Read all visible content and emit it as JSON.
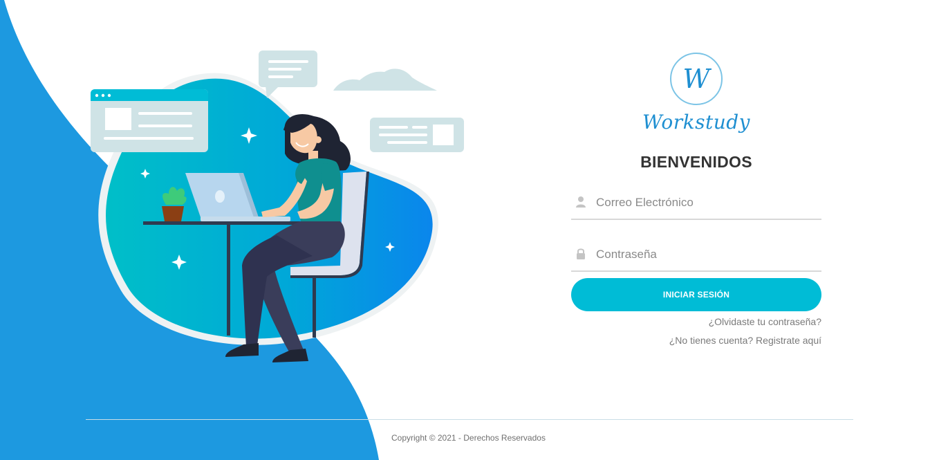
{
  "login": {
    "brand_letter": "W",
    "brand_name": "Workstudy",
    "title": "BIENVENIDOS",
    "email_placeholder": "Correo Electrónico",
    "password_placeholder": "Contraseña",
    "submit_label": "INICIAR SESIÓN",
    "forgot_link": "¿Olvidaste tu contraseña?",
    "register_link": "¿No tienes cuenta? Registrate aquí"
  },
  "footer": {
    "copyright": "Copyright © 2021 - Derechos Reservados"
  },
  "colors": {
    "accent": "#00bcd6",
    "brand": "#1f8fd1",
    "background_wave": "#1d99e0"
  },
  "icons": {
    "email": "user-icon",
    "password": "lock-icon"
  }
}
